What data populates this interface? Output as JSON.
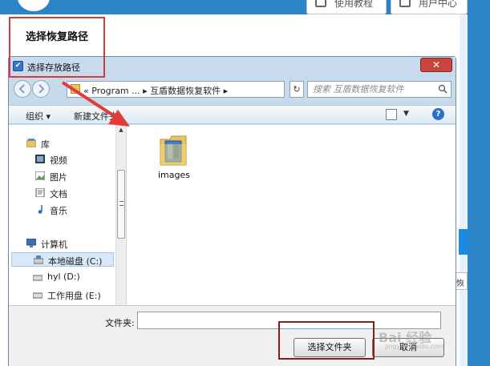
{
  "background_app": {
    "section_title": "选择恢复路径",
    "btn_tutorial": "使用教程",
    "btn_user": "用户中心",
    "right_btn": "恢复"
  },
  "dialog": {
    "title": "选择存放路径",
    "close": "✕",
    "address": {
      "prefix": "«",
      "segments": [
        "Program ...",
        "互盾数据恢复软件"
      ],
      "separator": "▸"
    },
    "search": {
      "placeholder": "搜索 互盾数据恢复软件"
    },
    "toolbar": {
      "organize": "组织 ▾",
      "new_folder": "新建文件夹",
      "help": "?"
    },
    "nav": {
      "library": "库",
      "videos": "视频",
      "pictures": "图片",
      "documents": "文档",
      "music": "音乐",
      "computer": "计算机",
      "local_disk": "本地磁盘 (C:)",
      "drive_d": "hyl (D:)",
      "drive_e": "工作用盘 (E:)"
    },
    "files": [
      {
        "name": "images"
      }
    ],
    "folder_label": "文件夹:",
    "folder_value": "",
    "btn_select": "选择文件夹",
    "btn_cancel": "取消"
  },
  "watermark": {
    "text": "Bai 经验",
    "sub": "jingyan.baidu.com"
  },
  "colors": {
    "accent_blue": "#2b84c6",
    "annotation_red": "#d43c3c",
    "dialog_frame": "#c5dbec"
  }
}
